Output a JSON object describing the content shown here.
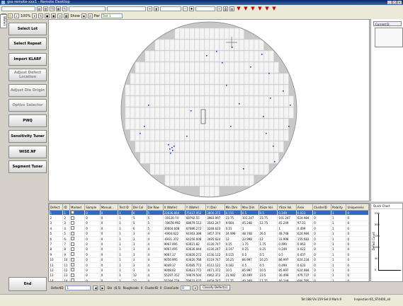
{
  "window": {
    "title": "gss-remote-xxx1 - Remote Desktop"
  },
  "toolbar": {
    "zoom": "100%",
    "show_label": "Show",
    "par_label": "Par",
    "test_value": "Test 1"
  },
  "side_tab": "Wafers",
  "left_buttons": [
    {
      "label": "Select Lot",
      "enabled": true
    },
    {
      "label": "Select Repeat",
      "enabled": true
    },
    {
      "label": "Import KLARF",
      "enabled": true
    },
    {
      "label": "Adjust Defect Location",
      "enabled": false
    },
    {
      "label": "Adjust Die Origin",
      "enabled": false
    },
    {
      "label": "Optics Selector",
      "enabled": false
    },
    {
      "label": "PWQ",
      "enabled": true
    },
    {
      "label": "Sensitivity Tuner",
      "enabled": true
    },
    {
      "label": "WISE.NF",
      "enabled": true
    },
    {
      "label": "Segment Tuner",
      "enabled": true
    }
  ],
  "end_button": "End",
  "right_panel": {
    "tab": "Current D"
  },
  "table": {
    "columns": [
      "Defect",
      "ID",
      "Marked",
      "Sample",
      "Manual...",
      "Test ID",
      "Die Col",
      "Die Row",
      "X (Wafer)",
      "Y (Wafer)",
      "Y (Die)",
      "Min Dim",
      "Max Dim",
      "XSize Vol.",
      "YSize Vol.",
      "Area",
      "ClusterID",
      "Polarity",
      "Uniqueness"
    ],
    "rows": [
      [
        "1",
        "1",
        "",
        "0",
        "0",
        "1",
        "6",
        "5",
        "23636.864",
        "75437.952",
        "3600.372",
        "0.155",
        "0.5",
        "0.5",
        "0.249",
        "0.023",
        "0",
        "1",
        "0"
      ],
      [
        "2",
        "2",
        "",
        "0",
        "0",
        "1",
        "5",
        "5",
        "-19120.74",
        "68792.55",
        "3983.997",
        "23.75",
        "101.247",
        "23.75",
        "101.247",
        "624.984",
        "0",
        "1",
        "0"
      ],
      [
        "3",
        "3",
        "",
        "0",
        "0",
        "1",
        "5",
        "5",
        "-19678.992",
        "68679.512",
        "3542.247",
        "9.664",
        "45.248",
        "12.75",
        "45.249",
        "97.31",
        "0",
        "1",
        "0"
      ],
      [
        "4",
        "4",
        "",
        "0",
        "0",
        "1",
        "6",
        "5",
        "30604.608",
        "67686.272",
        "3248.623",
        "0.31",
        "1",
        "1",
        "1",
        "0.499",
        "0",
        "1",
        "0"
      ],
      [
        "5",
        "5",
        "",
        "0",
        "0",
        "1",
        "3",
        "4",
        "-6904.622",
        "64363.388",
        "3457.374",
        "24.998",
        "48.748",
        "26.5",
        "48.748",
        "624.984",
        "0",
        "1",
        "0"
      ],
      [
        "6",
        "6",
        "",
        "0",
        "0",
        "1",
        "3",
        "4",
        "-6931.372",
        "64256.008",
        "3435.624",
        "12",
        "33.998",
        "12",
        "33.998",
        "155.683",
        "0",
        "1",
        "0"
      ],
      [
        "7",
        "7",
        "",
        "0",
        "0",
        "1",
        "3",
        "4",
        "9067.995",
        "63621.82",
        "4130.747",
        "0.25",
        "1.75",
        "1.75",
        "0.499",
        "0.063",
        "0",
        "1",
        "0"
      ],
      [
        "8",
        "8",
        "",
        "0",
        "0",
        "1",
        "3",
        "4",
        "9067.495",
        "63630.944",
        "4130.247",
        "0.147",
        "0.25",
        "0.25",
        "0.249",
        "0.022",
        "0",
        "1",
        "0"
      ],
      [
        "9",
        "9",
        "",
        "0",
        "0",
        "1",
        "3",
        "4",
        "9067.37",
        "63626.272",
        "4130.122",
        "0.155",
        "0.5",
        "0.5",
        "0.5",
        "0.037",
        "0",
        "1",
        "0"
      ],
      [
        "10",
        "10",
        "",
        "0",
        "0",
        "1",
        "3",
        "4",
        "9056.995",
        "63620.768",
        "4119.747",
        "16.25",
        "86.997",
        "16.25",
        "86.997",
        "624.234",
        "0",
        "1",
        "0"
      ],
      [
        "11",
        "11",
        "",
        "0",
        "0",
        "1",
        "3",
        "4",
        "9049.37",
        "63585.772",
        "4112.122",
        "0.182",
        "0.5",
        "0.5",
        "0.499",
        "0.033",
        "0",
        "1",
        "0"
      ],
      [
        "12",
        "12",
        "",
        "0",
        "0",
        "1",
        "3",
        "4",
        "9008.62",
        "63623.772",
        "4071.372",
        "10.5",
        "85.997",
        "10.5",
        "85.997",
        "624.984",
        "0",
        "1",
        "0"
      ],
      [
        "13",
        "13",
        "",
        "0",
        "0",
        "1",
        "12",
        "4",
        "55297.352",
        "59679.504",
        "4462.372",
        "21.902",
        "30.499",
        "23.5",
        "30.499",
        "479.737",
        "0",
        "1",
        "0"
      ],
      [
        "14",
        "14",
        "",
        "0",
        "0",
        "1",
        "12",
        "4",
        "55294.728",
        "59633.632",
        "4459.747",
        "17.75",
        "40.249",
        "17.75",
        "40.249",
        "666.795",
        "0",
        "1",
        "0"
      ],
      [
        "15",
        "15",
        "",
        "0",
        "0",
        "1",
        "12",
        "4",
        "55163.352",
        "59655.128",
        "4328.372",
        "8.5",
        "63.747",
        "8.5",
        "63.747",
        "624.921",
        "0",
        "1",
        "0"
      ]
    ]
  },
  "quick_chart": {
    "title": "Quick Chart",
    "ylabel": "Defect Count",
    "yticks": [
      "250",
      "200",
      "150",
      "100",
      "50",
      "0"
    ]
  },
  "bottom_bar": {
    "defect_id_label": "DefectID",
    "defect_id_value": "1",
    "die_label": "Die",
    "die_value": "(6,5)",
    "roughcode_label": "Roughcode",
    "roughcode_value": "0",
    "clusterid_label": "ClusterID",
    "clusterid_value": "0",
    "classcode_label": "ClassCode",
    "classcode_value": "0",
    "classify_button": "Classify Defect(s)"
  },
  "status": {
    "left": "Tot:188 Vis:159 Sel:0 Mark:0",
    "right": "Inspection:65_ST4400_all"
  }
}
